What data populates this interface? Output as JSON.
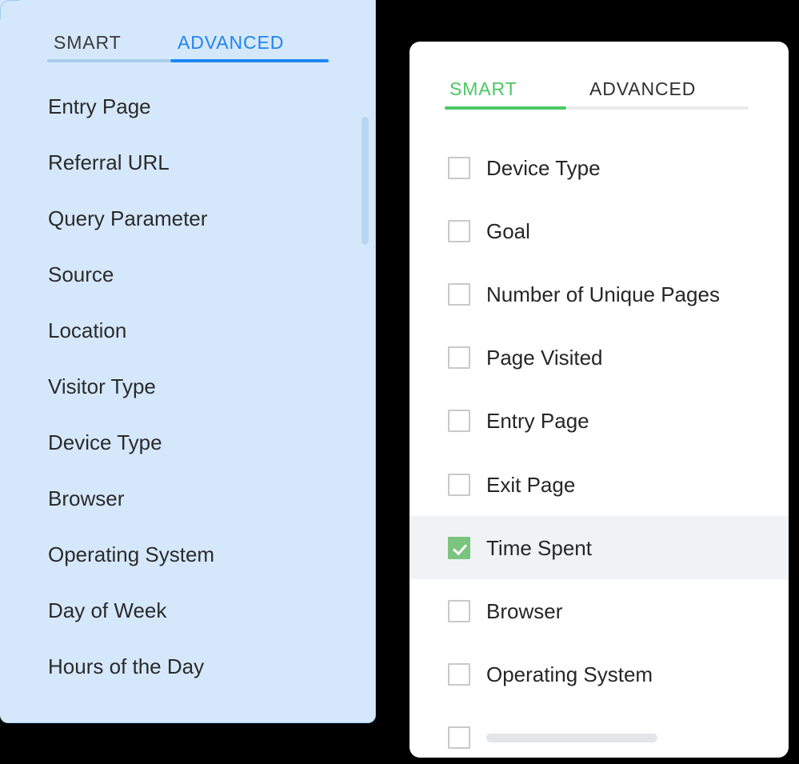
{
  "colors": {
    "left_panel_bg": "#d5e8fb",
    "left_panel_border": "#9ccbf5",
    "left_active_tab": "#2084f0",
    "left_active_underline": "#1e88f5",
    "left_inactive_underline": "#a8cdee",
    "left_scrollbar_thumb": "#b7d6f3",
    "right_card_bg": "#ffffff",
    "right_active_tab": "#4cc764",
    "right_inactive_underline": "#ebebeb",
    "checkbox_border": "#c9c9c9",
    "checkbox_checked_fill": "#7bc47f",
    "selected_row_bg": "#f1f2f4",
    "skeleton_bar": "#e4e5e7",
    "text_primary": "#262626",
    "page_bg": "#000000"
  },
  "left_panel": {
    "tabs": [
      {
        "label": "SMART",
        "active": false
      },
      {
        "label": "ADVANCED",
        "active": true
      }
    ],
    "items": [
      {
        "label": "Entry Page"
      },
      {
        "label": "Referral URL"
      },
      {
        "label": "Query Parameter"
      },
      {
        "label": "Source"
      },
      {
        "label": "Location"
      },
      {
        "label": "Visitor Type"
      },
      {
        "label": "Device Type"
      },
      {
        "label": "Browser"
      },
      {
        "label": "Operating System"
      },
      {
        "label": "Day of Week"
      },
      {
        "label": "Hours of the Day"
      }
    ],
    "scrollbar": {
      "visible": true
    }
  },
  "right_panel": {
    "tabs": [
      {
        "label": "SMART",
        "active": true
      },
      {
        "label": "ADVANCED",
        "active": false
      }
    ],
    "items": [
      {
        "label": "Device Type",
        "checked": false,
        "selected": false,
        "placeholder": false
      },
      {
        "label": "Goal",
        "checked": false,
        "selected": false,
        "placeholder": false
      },
      {
        "label": "Number of Unique Pages",
        "checked": false,
        "selected": false,
        "placeholder": false
      },
      {
        "label": "Page Visited",
        "checked": false,
        "selected": false,
        "placeholder": false
      },
      {
        "label": "Entry Page",
        "checked": false,
        "selected": false,
        "placeholder": false
      },
      {
        "label": "Exit Page",
        "checked": false,
        "selected": false,
        "placeholder": false
      },
      {
        "label": "Time Spent",
        "checked": true,
        "selected": true,
        "placeholder": false
      },
      {
        "label": "Browser",
        "checked": false,
        "selected": false,
        "placeholder": false
      },
      {
        "label": "Operating System",
        "checked": false,
        "selected": false,
        "placeholder": false
      },
      {
        "label": "",
        "checked": false,
        "selected": false,
        "placeholder": true
      }
    ]
  }
}
